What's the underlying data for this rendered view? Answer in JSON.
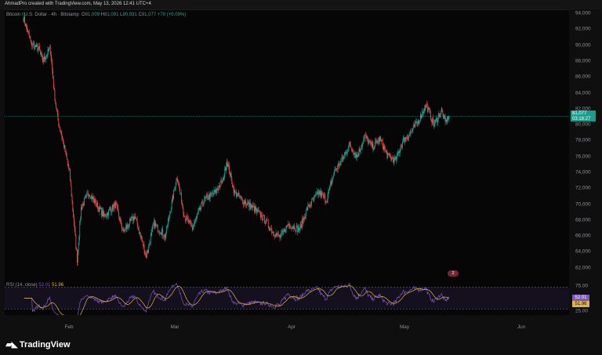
{
  "header": {
    "author_line": "AhmadPro created with TradingView.com, May 13, 2026 12:41 UTC+4"
  },
  "legend": {
    "symbol": "Bitcoin / U.S. Dollar · 4h · Bitstamp",
    "open_label": "O",
    "open": "81,009",
    "high_label": "H",
    "high": "81,091",
    "low_label": "L",
    "low": "80,931",
    "close_label": "C",
    "close": "81,077",
    "change": "+70 (+0.09%)"
  },
  "price_axis": {
    "ticks": [
      "94,000",
      "92,000",
      "90,000",
      "88,000",
      "86,000",
      "84,000",
      "82,000",
      "80,000",
      "78,000",
      "76,000",
      "74,000",
      "72,000",
      "70,000",
      "68,000",
      "66,000",
      "64,000",
      "62,000"
    ],
    "current_price": "81,077",
    "countdown": "03:18:27"
  },
  "event_badge": {
    "label": "2"
  },
  "rsi": {
    "label": "RSI (14, close)",
    "rsi_value": "52.01",
    "ma_value": "51.96",
    "ticks": [
      "75.00",
      "25.00"
    ]
  },
  "time_axis": {
    "ticks": [
      "Feb",
      "Mar",
      "Apr",
      "May",
      "Jun"
    ]
  },
  "footer": {
    "logo_text": "TradingView"
  },
  "colors": {
    "up": "#26a69a",
    "down": "#ef5350",
    "rsi": "#7e57c2",
    "rsi_ma": "#e3b341",
    "background": "#060606"
  },
  "chart_data": {
    "type": "candlestick",
    "instrument": "Bitcoin / U.S. Dollar",
    "timeframe": "4h",
    "ylim": [
      60500,
      94500
    ],
    "x_ticks": [
      "Feb",
      "Mar",
      "Apr",
      "May",
      "Jun"
    ],
    "close_path_keypoints": [
      [
        "2026-01-22",
        93500
      ],
      [
        "2026-01-24",
        90200
      ],
      [
        "2026-01-26",
        89500
      ],
      [
        "2026-01-27",
        88000
      ],
      [
        "2026-01-29",
        89600
      ],
      [
        "2026-01-30",
        84000
      ],
      [
        "2026-01-31",
        80500
      ],
      [
        "2026-02-01",
        78500
      ],
      [
        "2026-02-03",
        74000
      ],
      [
        "2026-02-05",
        63000
      ],
      [
        "2026-02-06",
        69500
      ],
      [
        "2026-02-08",
        71500
      ],
      [
        "2026-02-12",
        68500
      ],
      [
        "2026-02-15",
        70000
      ],
      [
        "2026-02-17",
        66500
      ],
      [
        "2026-02-20",
        68500
      ],
      [
        "2026-02-23",
        63500
      ],
      [
        "2026-02-25",
        67500
      ],
      [
        "2026-02-28",
        66000
      ],
      [
        "2026-03-03",
        73500
      ],
      [
        "2026-03-05",
        68500
      ],
      [
        "2026-03-07",
        67000
      ],
      [
        "2026-03-10",
        70500
      ],
      [
        "2026-03-13",
        71500
      ],
      [
        "2026-03-15",
        73000
      ],
      [
        "2026-03-16",
        75500
      ],
      [
        "2026-03-18",
        71500
      ],
      [
        "2026-03-20",
        70500
      ],
      [
        "2026-03-23",
        69500
      ],
      [
        "2026-03-26",
        68000
      ],
      [
        "2026-03-28",
        66500
      ],
      [
        "2026-03-30",
        65800
      ],
      [
        "2026-04-01",
        67500
      ],
      [
        "2026-04-04",
        66800
      ],
      [
        "2026-04-06",
        69500
      ],
      [
        "2026-04-09",
        71500
      ],
      [
        "2026-04-11",
        70500
      ],
      [
        "2026-04-13",
        74000
      ],
      [
        "2026-04-15",
        75500
      ],
      [
        "2026-04-17",
        77500
      ],
      [
        "2026-04-19",
        76000
      ],
      [
        "2026-04-21",
        78500
      ],
      [
        "2026-04-23",
        77200
      ],
      [
        "2026-04-25",
        78200
      ],
      [
        "2026-04-27",
        76000
      ],
      [
        "2026-04-29",
        75500
      ],
      [
        "2026-05-01",
        78000
      ],
      [
        "2026-05-03",
        79000
      ],
      [
        "2026-05-05",
        80500
      ],
      [
        "2026-05-07",
        82500
      ],
      [
        "2026-05-09",
        80000
      ],
      [
        "2026-05-11",
        81800
      ],
      [
        "2026-05-12",
        80300
      ],
      [
        "2026-05-13",
        81077
      ]
    ],
    "last_close": 81077,
    "rsi": {
      "period": 14,
      "value": 52.01,
      "ma": 51.96,
      "levels": [
        75,
        25
      ]
    }
  }
}
